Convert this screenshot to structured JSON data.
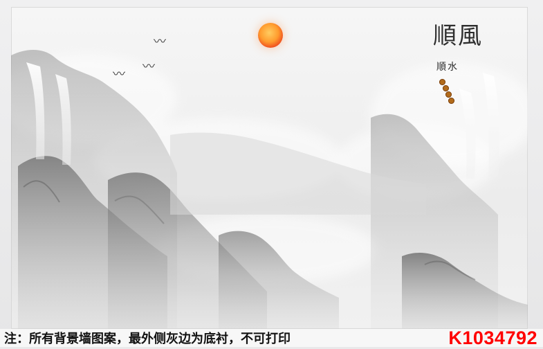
{
  "artwork": {
    "accent_colors": {
      "sun": "#ef4d1e",
      "code": "#ff0000",
      "ink": "#2d2d2d"
    },
    "title_calligraphy_main": "順風",
    "title_calligraphy_small": "順水"
  },
  "note": {
    "text": "注：所有背景墙图案，最外侧灰边为底衬，不可打印",
    "product_code": "K1034792"
  },
  "icons": {
    "sun": "sun-icon",
    "birds": "crane-icons",
    "seal": "seal-icon"
  }
}
